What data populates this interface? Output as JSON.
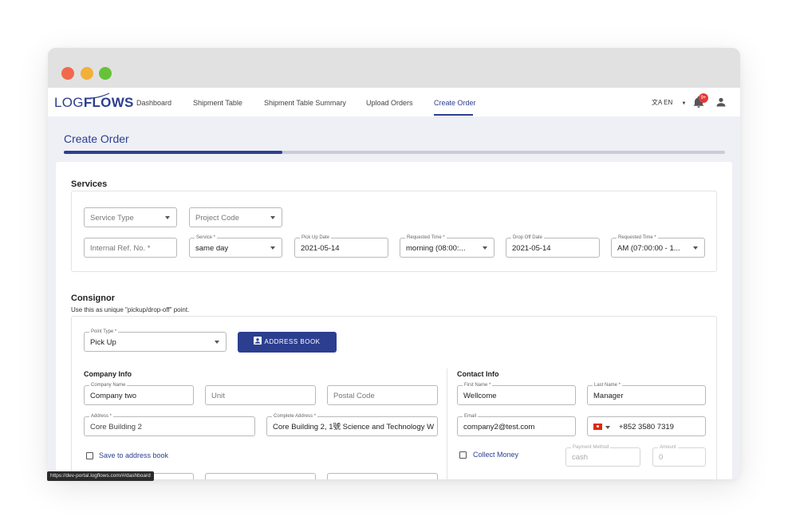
{
  "browser": {
    "status_url": "https://dev-portal.logflows.com/#/dashboard"
  },
  "header": {
    "logo_part1": "LOG",
    "logo_part2": "FLOWS",
    "nav": [
      {
        "label": "Dashboard",
        "active": false
      },
      {
        "label": "Shipment Table",
        "active": false
      },
      {
        "label": "Shipment Table Summary",
        "active": false
      },
      {
        "label": "Upload Orders",
        "active": false
      },
      {
        "label": "Create Order",
        "active": true
      }
    ],
    "language": "EN",
    "notifications_badge": "9+"
  },
  "page": {
    "title": "Create Order",
    "step_progress": 0.33
  },
  "services": {
    "title": "Services",
    "service_type": {
      "placeholder": "Service Type"
    },
    "project_code": {
      "placeholder": "Project Code"
    },
    "internal_ref": {
      "placeholder": "Internal Ref. No. *"
    },
    "service": {
      "label": "Service *",
      "value": "same day"
    },
    "pickup_date": {
      "label": "Pick Up Date",
      "value": "2021-05-14"
    },
    "requested_time_1": {
      "label": "Requested Time *",
      "value": "morning (08:00:..."
    },
    "dropoff_date": {
      "label": "Drop Off Date",
      "value": "2021-05-14"
    },
    "requested_time_2": {
      "label": "Requested Time *",
      "value": "AM (07:00:00 - 1..."
    }
  },
  "consignor": {
    "title": "Consignor",
    "subtitle": "Use this as unique \"pickup/drop-off\" point.",
    "point_type": {
      "label": "Point Type *",
      "value": "Pick Up"
    },
    "address_book_button": "ADDRESS BOOK",
    "company_info": {
      "title": "Company Info",
      "company_name": {
        "label": "Company Name",
        "value": "Company two"
      },
      "unit": {
        "placeholder": "Unit"
      },
      "postal_code": {
        "placeholder": "Postal Code"
      },
      "address": {
        "label": "Address *",
        "value": "Core Building 2"
      },
      "complete_address": {
        "label": "Complete Address *",
        "value": "Core Building 2, 1號 Science and Technology W"
      },
      "save_to_address_book": "Save to address book"
    },
    "contact_info": {
      "title": "Contact Info",
      "first_name": {
        "label": "First Name *",
        "value": "Wellcome"
      },
      "last_name": {
        "label": "Last Name *",
        "value": "Manager"
      },
      "email": {
        "label": "Email",
        "value": "company2@test.com"
      },
      "phone": {
        "value": "+852 3580 7319"
      },
      "collect_money": "Collect Money",
      "payment_method": {
        "label": "Payment Method",
        "placeholder": "cash"
      },
      "amount": {
        "label": "Amount",
        "placeholder": "0"
      }
    }
  },
  "colors": {
    "primary": "#2c3e8f",
    "badge": "#e53935",
    "progress_track": "#c8ccd8"
  }
}
